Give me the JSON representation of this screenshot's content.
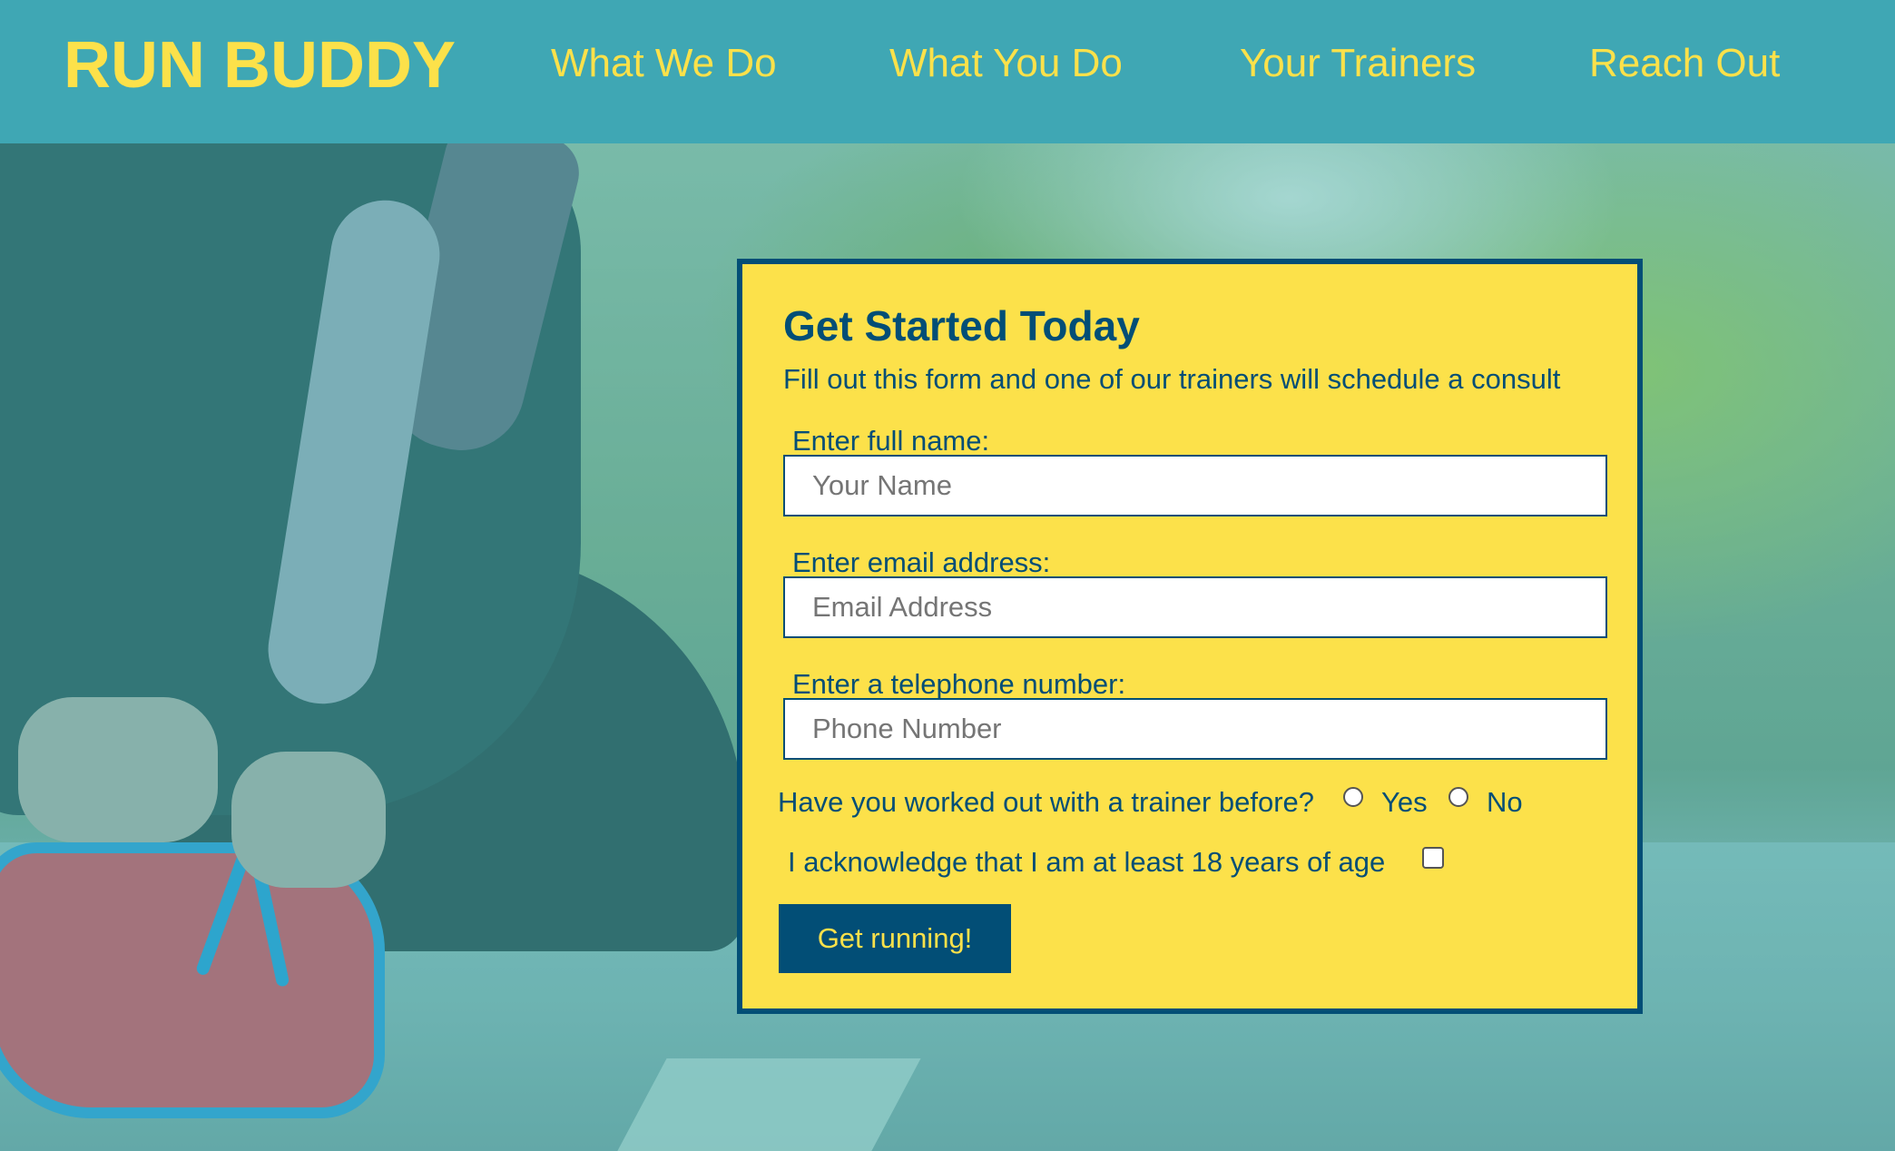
{
  "header": {
    "logo": "RUN BUDDY",
    "nav": [
      {
        "label": "What We Do"
      },
      {
        "label": "What You Do"
      },
      {
        "label": "Your Trainers"
      },
      {
        "label": "Reach Out"
      }
    ]
  },
  "form": {
    "title": "Get Started Today",
    "subtitle": "Fill out this form and one of our trainers will schedule a consult",
    "name_label": "Enter full name:",
    "name_placeholder": "Your Name",
    "email_label": "Enter email address:",
    "email_placeholder": "Email Address",
    "phone_label": "Enter a telephone number:",
    "phone_placeholder": "Phone Number",
    "trainer_question": "Have you worked out with a trainer before?",
    "yes_label": "Yes",
    "no_label": "No",
    "age_ack": "I acknowledge that I am at least 18 years of age",
    "submit_label": "Get running!"
  },
  "colors": {
    "header_bg": "#3fa7b4",
    "brand_yellow": "#fce14a",
    "navy": "#024e76"
  }
}
